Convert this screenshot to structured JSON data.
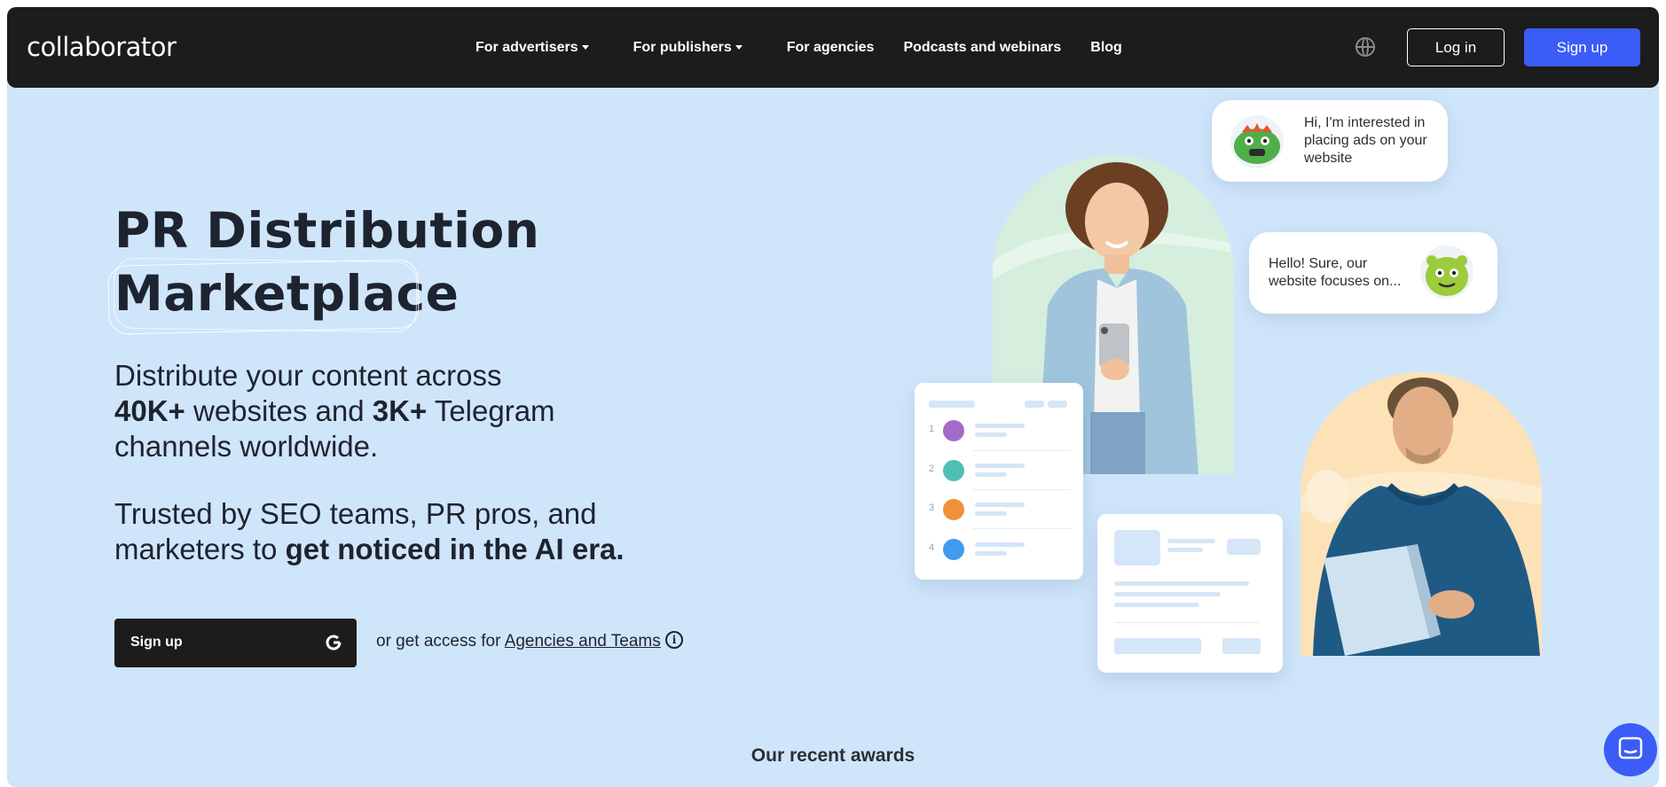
{
  "nav": {
    "logo": "collaborator",
    "links": [
      {
        "label": "For advertisers",
        "dropdown": true
      },
      {
        "label": "For publishers",
        "dropdown": true
      },
      {
        "label": "For agencies",
        "dropdown": false
      },
      {
        "label": "Podcasts and webinars",
        "dropdown": false
      },
      {
        "label": "Blog",
        "dropdown": false
      }
    ],
    "globe_icon": "globe-icon",
    "login_label": "Log in",
    "signup_label": "Sign up"
  },
  "hero": {
    "title_line1": "PR Distribution",
    "title_line2": "Marketplace",
    "desc": {
      "t1": "Distribute your content across",
      "b1": "40K+",
      "t2": " websites and ",
      "b2": "3K+",
      "t3": " Telegram",
      "t4": "channels worldwide."
    },
    "trusted": {
      "t1": "Trusted by SEO teams, PR pros, and",
      "t2": "marketers to ",
      "b1": "get noticed in the AI era."
    },
    "cta_label": "Sign up",
    "access_prefix": "or get access for ",
    "access_link": "Agencies and Teams"
  },
  "chat": {
    "bubble1": "Hi, I'm interested in placing ads on your website",
    "bubble2": "Hello! Sure, our website focuses on..."
  },
  "list_card": {
    "rows": [
      {
        "num": "1",
        "color": "#a46ac9"
      },
      {
        "num": "2",
        "color": "#4fbfb6"
      },
      {
        "num": "3",
        "color": "#f0913a"
      },
      {
        "num": "4",
        "color": "#3f9af0"
      }
    ]
  },
  "awards_title": "Our recent awards",
  "colors": {
    "background": "#cfe5fa",
    "nav": "#1c1c1c",
    "accent": "#3b5cf6"
  }
}
